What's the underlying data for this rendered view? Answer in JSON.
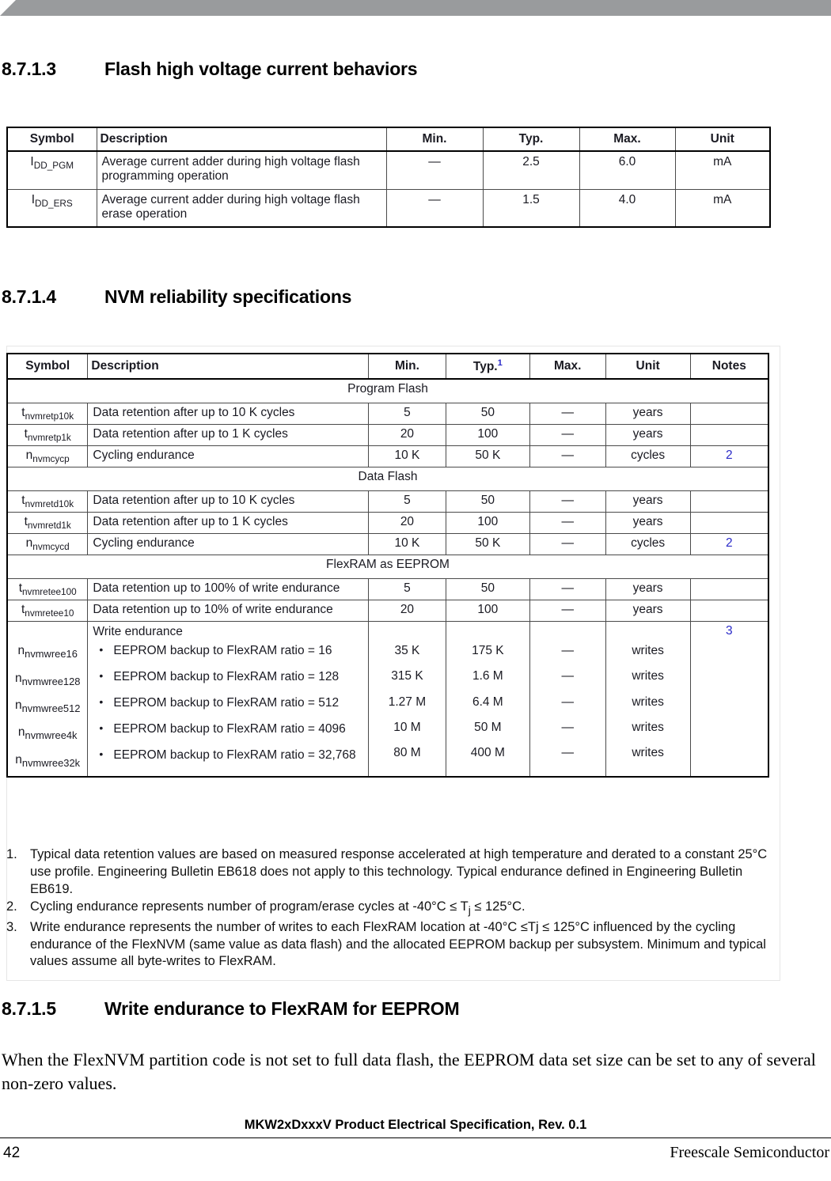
{
  "colors": {
    "banner": "#999b9d",
    "note_link": "#2a2ac8",
    "table_border": "#4a4a4a"
  },
  "sections": {
    "s3": {
      "number": "8.7.1.3",
      "title": "Flash high voltage current behaviors"
    },
    "s4": {
      "number": "8.7.1.4",
      "title": "NVM reliability specifications"
    },
    "s5": {
      "number": "8.7.1.5",
      "title": "Write endurance to FlexRAM for EEPROM"
    }
  },
  "table1": {
    "headers": [
      "Symbol",
      "Description",
      "Min.",
      "Typ.",
      "Max.",
      "Unit"
    ],
    "rows": [
      {
        "symbol_base": "I",
        "symbol_sub": "DD_PGM",
        "description": "Average current adder during high voltage flash programming operation",
        "min": "—",
        "typ": "2.5",
        "max": "6.0",
        "unit": "mA"
      },
      {
        "symbol_base": "I",
        "symbol_sub": "DD_ERS",
        "description": "Average current adder during high voltage flash erase operation",
        "min": "—",
        "typ": "1.5",
        "max": "4.0",
        "unit": "mA"
      }
    ]
  },
  "table2": {
    "headers": [
      "Symbol",
      "Description",
      "Min.",
      "Typ.",
      "Max.",
      "Unit",
      "Notes"
    ],
    "typ_footnote_marker": "1",
    "group_program_flash": "Program Flash",
    "group_data_flash": "Data Flash",
    "group_flexram": "FlexRAM as EEPROM",
    "rows_program_flash": [
      {
        "symbol_base": "t",
        "symbol_sub": "nvmretp10k",
        "description": "Data retention after up to 10 K cycles",
        "min": "5",
        "typ": "50",
        "max": "—",
        "unit": "years",
        "notes": ""
      },
      {
        "symbol_base": "t",
        "symbol_sub": "nvmretp1k",
        "description": "Data retention after up to 1 K cycles",
        "min": "20",
        "typ": "100",
        "max": "—",
        "unit": "years",
        "notes": ""
      },
      {
        "symbol_base": "n",
        "symbol_sub": "nvmcycp",
        "description": "Cycling endurance",
        "min": "10 K",
        "typ": "50 K",
        "max": "—",
        "unit": "cycles",
        "notes": "2"
      }
    ],
    "rows_data_flash": [
      {
        "symbol_base": "t",
        "symbol_sub": "nvmretd10k",
        "description": "Data retention after up to 10 K cycles",
        "min": "5",
        "typ": "50",
        "max": "—",
        "unit": "years",
        "notes": ""
      },
      {
        "symbol_base": "t",
        "symbol_sub": "nvmretd1k",
        "description": "Data retention after up to 1 K cycles",
        "min": "20",
        "typ": "100",
        "max": "—",
        "unit": "years",
        "notes": ""
      },
      {
        "symbol_base": "n",
        "symbol_sub": "nvmcycd",
        "description": "Cycling endurance",
        "min": "10 K",
        "typ": "50 K",
        "max": "—",
        "unit": "cycles",
        "notes": "2"
      }
    ],
    "rows_flexram": [
      {
        "symbol_base": "t",
        "symbol_sub": "nvmretee100",
        "description": "Data retention up to 100% of write endurance",
        "min": "5",
        "typ": "50",
        "max": "—",
        "unit": "years",
        "notes": ""
      },
      {
        "symbol_base": "t",
        "symbol_sub": "nvmretee10",
        "description": "Data retention up to 10% of write endurance",
        "min": "20",
        "typ": "100",
        "max": "—",
        "unit": "years",
        "notes": ""
      }
    ],
    "write_endurance": {
      "title": "Write endurance",
      "notes": "3",
      "items": [
        {
          "symbol_base": "n",
          "symbol_sub": "nvmwree16",
          "bullet": "EEPROM backup to FlexRAM ratio = 16",
          "min": "35 K",
          "typ": "175 K",
          "max": "—",
          "unit": "writes"
        },
        {
          "symbol_base": "n",
          "symbol_sub": "nvmwree128",
          "bullet": "EEPROM backup to FlexRAM ratio = 128",
          "min": "315 K",
          "typ": "1.6 M",
          "max": "—",
          "unit": "writes"
        },
        {
          "symbol_base": "n",
          "symbol_sub": "nvmwree512",
          "bullet": "EEPROM backup to FlexRAM ratio = 512",
          "min": "1.27 M",
          "typ": "6.4 M",
          "max": "—",
          "unit": "writes"
        },
        {
          "symbol_base": "n",
          "symbol_sub": "nvmwree4k",
          "bullet": "EEPROM backup to FlexRAM ratio = 4096",
          "min": "10 M",
          "typ": "50 M",
          "max": "—",
          "unit": "writes"
        },
        {
          "symbol_base": "n",
          "symbol_sub": "nvmwree32k",
          "bullet": "EEPROM backup to FlexRAM ratio = 32,768",
          "min": "80 M",
          "typ": "400 M",
          "max": "—",
          "unit": "writes"
        }
      ]
    }
  },
  "footnotes": [
    {
      "num": "1.",
      "text": "Typical data retention values are based on measured response accelerated at high temperature and derated to a constant 25°C use profile. Engineering Bulletin EB618 does not apply to this technology. Typical endurance defined in Engineering Bulletin EB619."
    },
    {
      "num": "2.",
      "text_a": "Cycling endurance represents number of program/erase cycles at -40°C ≤ T",
      "sub": "j",
      "text_b": " ≤ 125°C."
    },
    {
      "num": "3.",
      "text": "Write endurance represents the number of writes to each FlexRAM location at -40°C ≤Tj ≤ 125°C influenced by the cycling endurance of the FlexNVM (same value as data flash) and the allocated EEPROM backup per subsystem. Minimum and typical values assume all byte-writes to FlexRAM."
    }
  ],
  "body_paragraph": "When the FlexNVM partition code is not set to full data flash, the EEPROM data set size can be set to any of several non-zero values.",
  "footer": {
    "title": "MKW2xDxxxV Product Electrical Specification, Rev. 0.1",
    "page": "42",
    "company": "Freescale Semiconductor"
  }
}
